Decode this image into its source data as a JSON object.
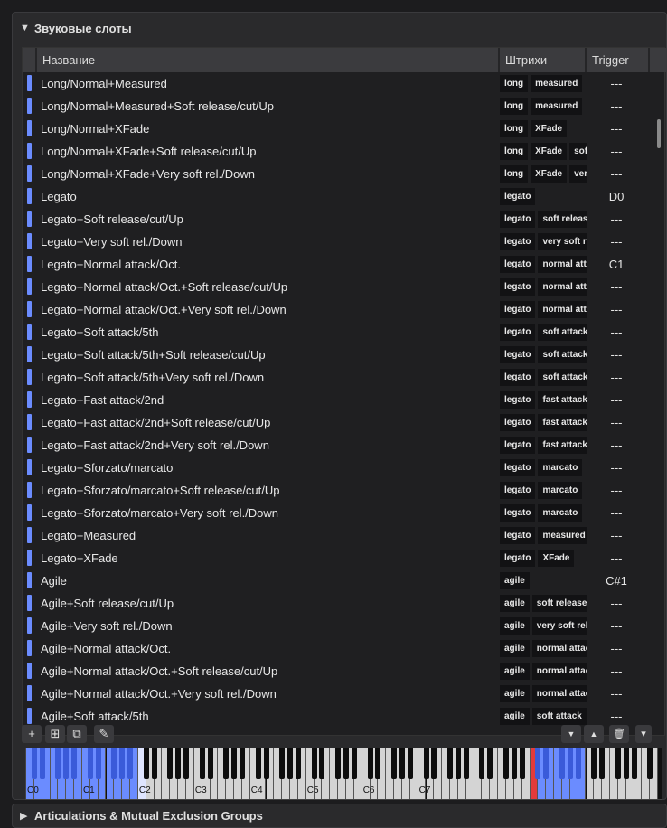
{
  "section": {
    "title": "Звуковые слоты",
    "toggle": "▼"
  },
  "columns": {
    "name": "Название",
    "strokes": "Штрихи",
    "trigger": "Trigger"
  },
  "rows": [
    {
      "name": "Long/Normal+Measured",
      "tags": [
        "long",
        "measured"
      ],
      "trigger": "---"
    },
    {
      "name": "Long/Normal+Measured+Soft release/cut/Up",
      "tags": [
        "long",
        "measured"
      ],
      "trigger": "---"
    },
    {
      "name": "Long/Normal+XFade",
      "tags": [
        "long",
        "XFade"
      ],
      "trigger": "---"
    },
    {
      "name": "Long/Normal+XFade+Soft release/cut/Up",
      "tags": [
        "long",
        "XFade",
        "soft"
      ],
      "trigger": "---"
    },
    {
      "name": "Long/Normal+XFade+Very soft rel./Down",
      "tags": [
        "long",
        "XFade",
        "very"
      ],
      "trigger": "---"
    },
    {
      "name": "Legato",
      "tags": [
        "legato"
      ],
      "trigger": "D0"
    },
    {
      "name": "Legato+Soft release/cut/Up",
      "tags": [
        "legato",
        "soft release"
      ],
      "trigger": "---"
    },
    {
      "name": "Legato+Very soft rel./Down",
      "tags": [
        "legato",
        "very soft rel"
      ],
      "trigger": "---"
    },
    {
      "name": "Legato+Normal attack/Oct.",
      "tags": [
        "legato",
        "normal attack"
      ],
      "trigger": "C1"
    },
    {
      "name": "Legato+Normal attack/Oct.+Soft release/cut/Up",
      "tags": [
        "legato",
        "normal attack"
      ],
      "trigger": "---"
    },
    {
      "name": "Legato+Normal attack/Oct.+Very soft rel./Down",
      "tags": [
        "legato",
        "normal attack"
      ],
      "trigger": "---"
    },
    {
      "name": "Legato+Soft attack/5th",
      "tags": [
        "legato",
        "soft attack"
      ],
      "trigger": "---"
    },
    {
      "name": "Legato+Soft attack/5th+Soft release/cut/Up",
      "tags": [
        "legato",
        "soft attack"
      ],
      "trigger": "---"
    },
    {
      "name": "Legato+Soft attack/5th+Very soft rel./Down",
      "tags": [
        "legato",
        "soft attack"
      ],
      "trigger": "---"
    },
    {
      "name": "Legato+Fast attack/2nd",
      "tags": [
        "legato",
        "fast attack"
      ],
      "trigger": "---"
    },
    {
      "name": "Legato+Fast attack/2nd+Soft release/cut/Up",
      "tags": [
        "legato",
        "fast attack"
      ],
      "trigger": "---"
    },
    {
      "name": "Legato+Fast attack/2nd+Very soft rel./Down",
      "tags": [
        "legato",
        "fast attack"
      ],
      "trigger": "---"
    },
    {
      "name": "Legato+Sforzato/marcato",
      "tags": [
        "legato",
        "marcato"
      ],
      "trigger": "---"
    },
    {
      "name": "Legato+Sforzato/marcato+Soft release/cut/Up",
      "tags": [
        "legato",
        "marcato"
      ],
      "trigger": "---"
    },
    {
      "name": "Legato+Sforzato/marcato+Very soft rel./Down",
      "tags": [
        "legato",
        "marcato"
      ],
      "trigger": "---"
    },
    {
      "name": "Legato+Measured",
      "tags": [
        "legato",
        "measured"
      ],
      "trigger": "---"
    },
    {
      "name": "Legato+XFade",
      "tags": [
        "legato",
        "XFade"
      ],
      "trigger": "---"
    },
    {
      "name": "Agile",
      "tags": [
        "agile"
      ],
      "trigger": "C#1"
    },
    {
      "name": "Agile+Soft release/cut/Up",
      "tags": [
        "agile",
        "soft release"
      ],
      "trigger": "---"
    },
    {
      "name": "Agile+Very soft rel./Down",
      "tags": [
        "agile",
        "very soft rel"
      ],
      "trigger": "---"
    },
    {
      "name": "Agile+Normal attack/Oct.",
      "tags": [
        "agile",
        "normal attack"
      ],
      "trigger": "---"
    },
    {
      "name": "Agile+Normal attack/Oct.+Soft release/cut/Up",
      "tags": [
        "agile",
        "normal attack"
      ],
      "trigger": "---"
    },
    {
      "name": "Agile+Normal attack/Oct.+Very soft rel./Down",
      "tags": [
        "agile",
        "normal attack"
      ],
      "trigger": "---"
    },
    {
      "name": "Agile+Soft attack/5th",
      "tags": [
        "agile",
        "soft attack"
      ],
      "trigger": "---"
    }
  ],
  "toolbar": {
    "add": "+",
    "add_multi": "⊞",
    "duplicate": "⧉",
    "edit": "✎",
    "move_down": "▼",
    "move_up": "▲",
    "delete": "🗑",
    "menu": "▾"
  },
  "keyboard": {
    "octave_labels": [
      "C0",
      "C1",
      "C2",
      "C3",
      "C4",
      "C5",
      "C6",
      "C7"
    ]
  },
  "section2": {
    "title": "Articulations & Mutual Exclusion Groups",
    "toggle": "▶"
  },
  "colors": {
    "accent": "#6b8cff",
    "trigger_key": "#e23b3b"
  }
}
